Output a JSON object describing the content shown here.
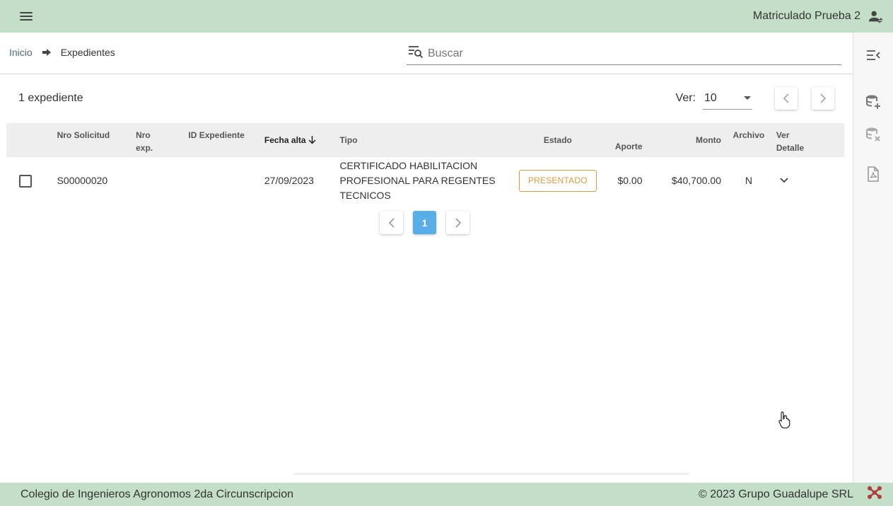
{
  "header": {
    "user_name": "Matriculado Prueba 2"
  },
  "breadcrumb": {
    "home": "Inicio",
    "current": "Expedientes"
  },
  "search": {
    "placeholder": "Buscar"
  },
  "list": {
    "count_label": "1 expediente",
    "ver_label": "Ver:",
    "page_size": "10"
  },
  "table": {
    "columns": {
      "nro_solicitud": "Nro Solicitud",
      "nro_exp_1": "Nro",
      "nro_exp_2": "exp.",
      "id_expediente": "ID Expediente",
      "fecha_alta": "Fecha alta",
      "tipo": "Tipo",
      "estado": "Estado",
      "aporte": "Aporte",
      "monto": "Monto",
      "archivo": "Archivo",
      "ver_detalle_1": "Ver",
      "ver_detalle_2": "Detalle"
    },
    "rows": [
      {
        "nro_solicitud": "S00000020",
        "nro_exp": "",
        "id_expediente": "",
        "fecha_alta": "27/09/2023",
        "tipo": "CERTIFICADO HABILITACION PROFESIONAL PARA REGENTES TECNICOS",
        "estado": "PRESENTADO",
        "aporte": "$0.00",
        "monto": "$40,700.00",
        "archivo": "N"
      }
    ]
  },
  "pagination": {
    "current_page": "1"
  },
  "footer": {
    "left": "Colegio de Ingenieros Agronomos 2da Circunscripcion",
    "right": "© 2023 Grupo Guadalupe SRL"
  },
  "colors": {
    "header_bg": "#c3dfc8",
    "badge": "#e39b3a",
    "active_page": "#5aaee8",
    "link": "#4a6d86"
  }
}
